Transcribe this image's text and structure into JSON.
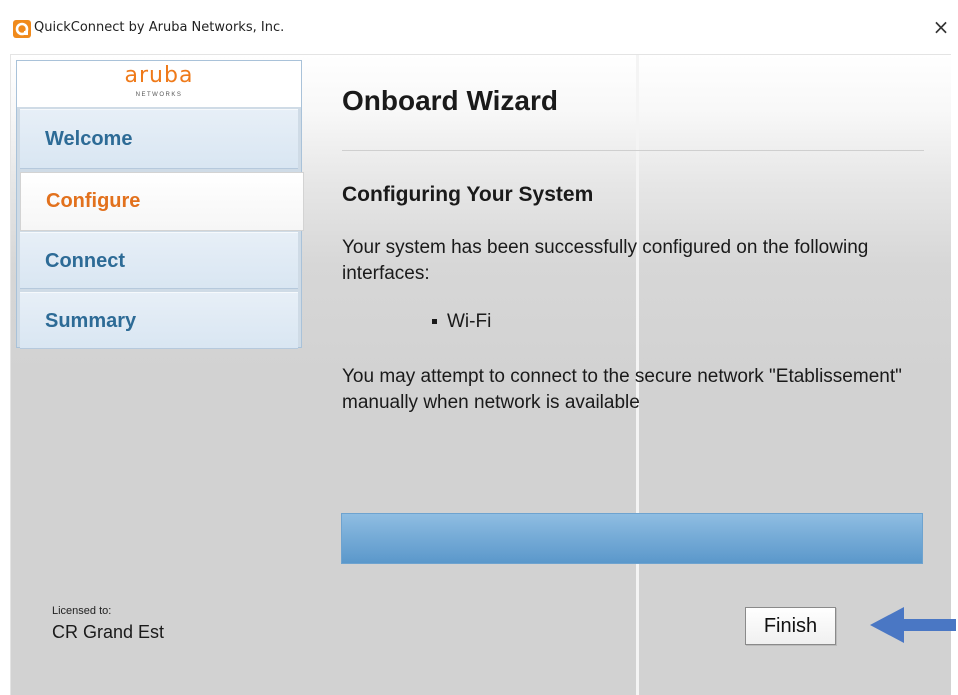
{
  "window": {
    "title": "QuickConnect by Aruba Networks, Inc.",
    "close_glyph": "×",
    "icon": "quickconnect-orange-ring-icon"
  },
  "sidebar": {
    "logo": {
      "wordmark": "aruba",
      "subtext": "NETWORKS"
    },
    "items": [
      {
        "label": "Welcome",
        "state": "inactive"
      },
      {
        "label": "Configure",
        "state": "active"
      },
      {
        "label": "Connect",
        "state": "inactive"
      },
      {
        "label": "Summary",
        "state": "inactive"
      }
    ]
  },
  "main": {
    "heading": "Onboard Wizard",
    "section_title": "Configuring Your System",
    "paragraph1": "Your system has been successfully configured on the following interfaces:",
    "interfaces": [
      "Wi-Fi"
    ],
    "paragraph2": "You may attempt to connect to the secure network \"Etablissement\" manually when network is available",
    "progress": 1.0
  },
  "footer": {
    "license_label": "Licensed to:",
    "license_value": "CR Grand Est",
    "finish_label": "Finish"
  },
  "annotation": {
    "arrow": "blue-arrow-pointing-left"
  },
  "colors": {
    "brand_orange": "#ef7a1a",
    "nav_text": "#2d6b96",
    "active_nav_text": "#e2711d",
    "progress_blue": "#74aad6",
    "arrow_blue": "#4a77c4"
  }
}
